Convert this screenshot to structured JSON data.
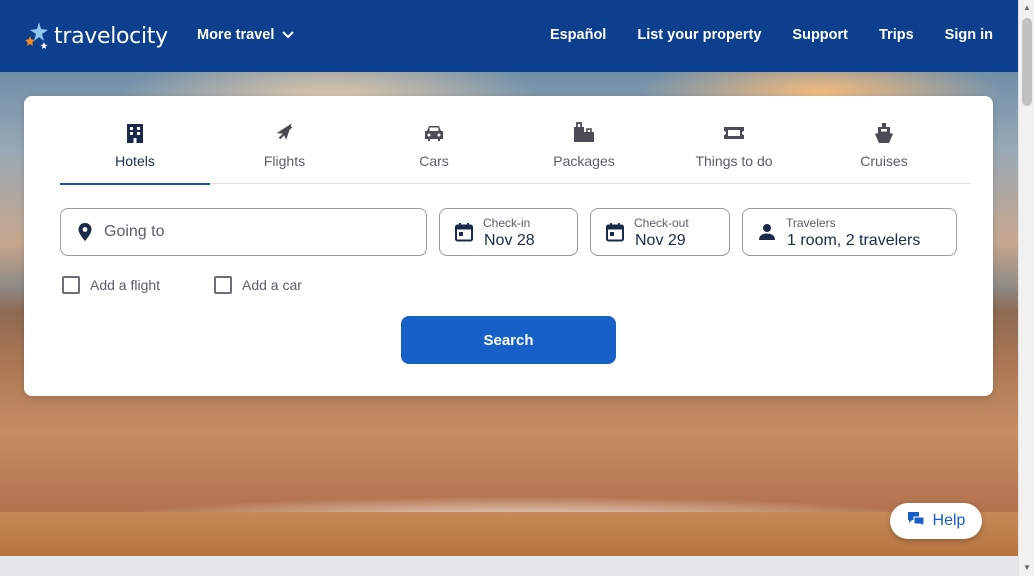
{
  "header": {
    "logo_text": "travelocity",
    "more_travel": "More travel",
    "nav": [
      "Español",
      "List your property",
      "Support",
      "Trips",
      "Sign in"
    ]
  },
  "tabs": [
    {
      "label": "Hotels",
      "icon": "building-icon",
      "active": true
    },
    {
      "label": "Flights",
      "icon": "airplane-icon",
      "active": false
    },
    {
      "label": "Cars",
      "icon": "car-icon",
      "active": false
    },
    {
      "label": "Packages",
      "icon": "luggage-icon",
      "active": false
    },
    {
      "label": "Things to do",
      "icon": "ticket-icon",
      "active": false
    },
    {
      "label": "Cruises",
      "icon": "ship-icon",
      "active": false
    }
  ],
  "search": {
    "going_to_placeholder": "Going to",
    "checkin_label": "Check-in",
    "checkin_value": "Nov 28",
    "checkout_label": "Check-out",
    "checkout_value": "Nov 29",
    "travelers_label": "Travelers",
    "travelers_value": "1 room, 2 travelers",
    "add_flight": "Add a flight",
    "add_car": "Add a car",
    "search_button": "Search"
  },
  "help": {
    "label": "Help"
  },
  "colors": {
    "header_bg": "#0d3f8f",
    "primary_button": "#1660c7",
    "active_tab_underline": "#1e4fa3",
    "text_dark": "#1a2b49"
  }
}
